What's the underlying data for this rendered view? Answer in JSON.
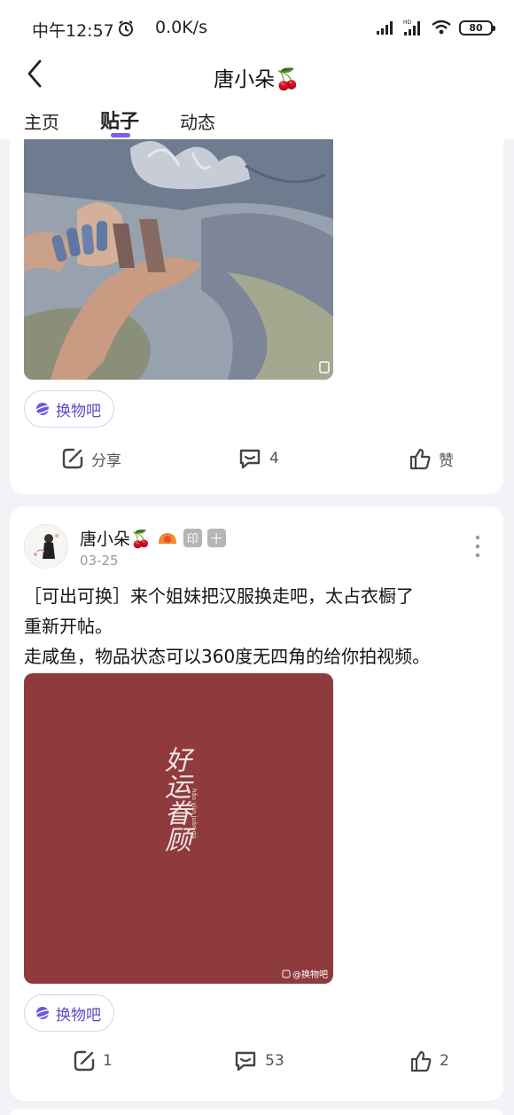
{
  "status_bar": {
    "time": "中午12:57",
    "net_speed": "0.0K/s",
    "battery": "80",
    "icons": [
      "alarm-icon",
      "signal-icon",
      "hd-signal-icon",
      "wifi-icon",
      "battery-icon"
    ]
  },
  "header": {
    "title": "唐小朵🍒",
    "back_icon": "chevron-left-icon"
  },
  "tabs": [
    {
      "label": "主页",
      "active": false
    },
    {
      "label": "贴子",
      "active": true
    },
    {
      "label": "动态",
      "active": false
    }
  ],
  "colors": {
    "accent": "#7b5cf5",
    "tag_text": "#5f49c4",
    "card_bg": "#ffffff",
    "page_bg": "#f4f2f6",
    "post2_image_bg": "#8f3a3d"
  },
  "posts": [
    {
      "tag": "换物吧",
      "actions": {
        "share": "分享",
        "comments": "4",
        "likes": "赞"
      }
    },
    {
      "author": "唐小朵🍒",
      "badge_label": "印",
      "badge_extra": "十",
      "date": "03-25",
      "body_lines": [
        "［可出可换］来个姐妹把汉服换走吧，太占衣橱了",
        "重新开帖。",
        "走咸鱼，物品状态可以360度无四角的给你拍视频。"
      ],
      "image_watermark": "@换物吧",
      "image_text": "好运眷顾",
      "image_subtext": "hǎo yùn juàn gù",
      "tag": "换物吧",
      "actions": {
        "share": "1",
        "comments": "53",
        "likes": "2"
      }
    }
  ]
}
